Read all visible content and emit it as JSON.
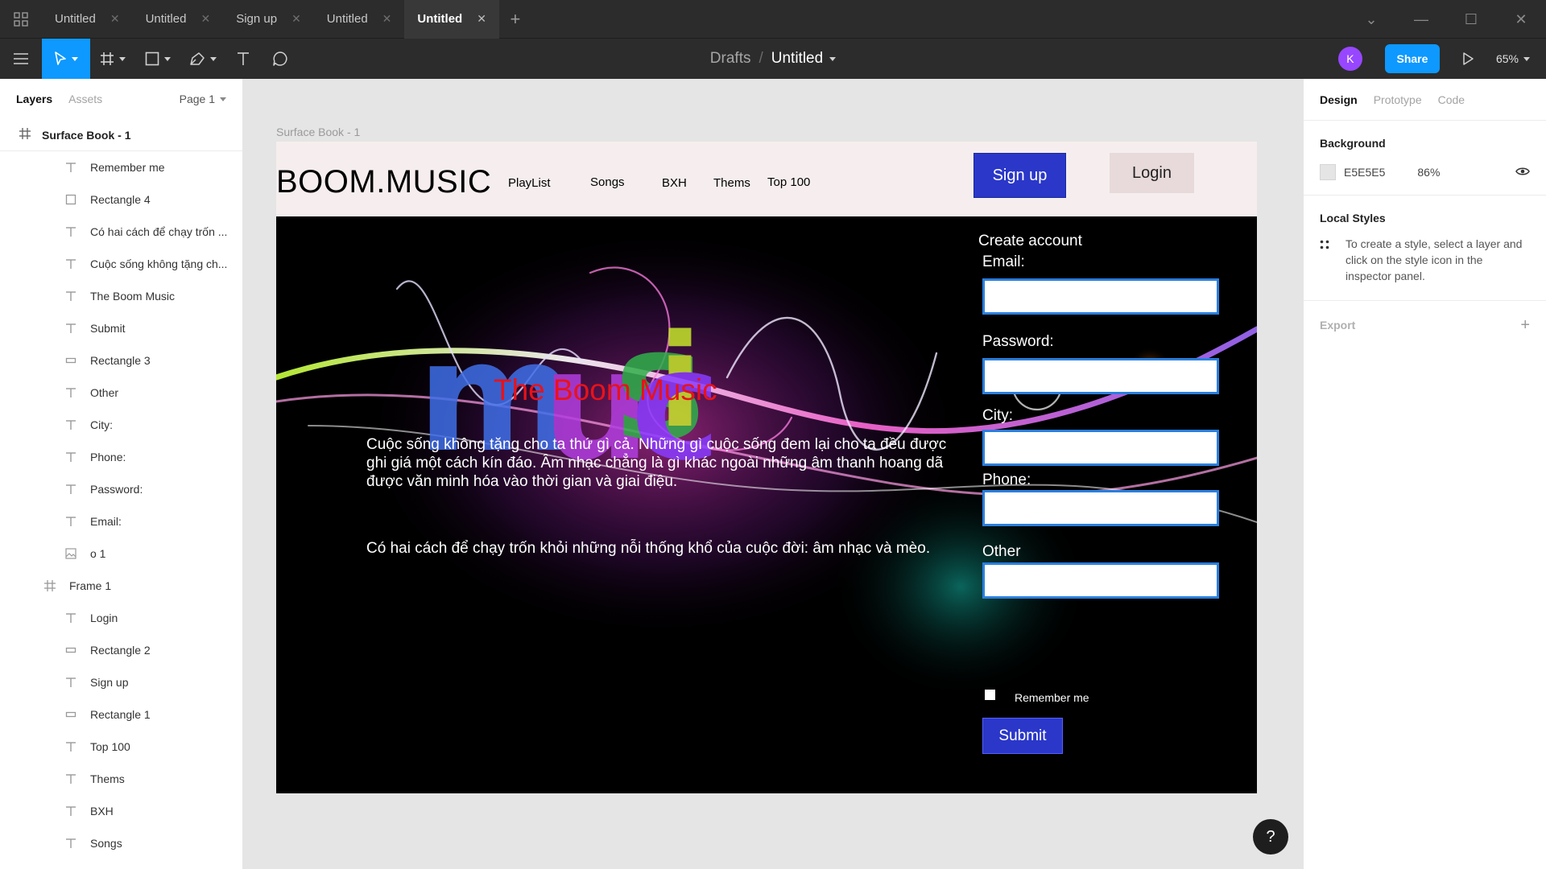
{
  "tabs": [
    {
      "label": "Untitled",
      "active": false
    },
    {
      "label": "Untitled",
      "active": false
    },
    {
      "label": "Sign up",
      "active": false
    },
    {
      "label": "Untitled",
      "active": false
    },
    {
      "label": "Untitled",
      "active": true
    }
  ],
  "toolbar": {
    "breadcrumb_parent": "Drafts",
    "breadcrumb_sep": "/",
    "file_name": "Untitled",
    "avatar_initial": "K",
    "share_label": "Share",
    "zoom": "65%",
    "accent": "#0d99ff"
  },
  "left_panel": {
    "tab_layers": "Layers",
    "tab_assets": "Assets",
    "page": "Page 1",
    "top_frame": "Surface Book - 1",
    "layers": [
      {
        "label": "Remember me",
        "icon": "text-icon"
      },
      {
        "label": "Rectangle 4",
        "icon": "rectangle-icon"
      },
      {
        "label": "Có hai cách để chạy trốn ...",
        "icon": "text-icon"
      },
      {
        "label": "Cuộc sống không tặng ch...",
        "icon": "text-icon"
      },
      {
        "label": "The Boom Music",
        "icon": "text-icon"
      },
      {
        "label": "Submit",
        "icon": "text-icon"
      },
      {
        "label": "Rectangle 3",
        "icon": "flat-rectangle-icon"
      },
      {
        "label": "Other",
        "icon": "text-icon"
      },
      {
        "label": "City:",
        "icon": "text-icon"
      },
      {
        "label": "Phone:",
        "icon": "text-icon"
      },
      {
        "label": "Password:",
        "icon": "text-icon"
      },
      {
        "label": "Email:",
        "icon": "text-icon"
      },
      {
        "label": "o 1",
        "icon": "image-icon"
      },
      {
        "label": "Frame 1",
        "icon": "frame-icon",
        "frame": true
      },
      {
        "label": "Login",
        "icon": "text-icon"
      },
      {
        "label": "Rectangle 2",
        "icon": "flat-rectangle-icon"
      },
      {
        "label": "Sign up",
        "icon": "text-icon"
      },
      {
        "label": "Rectangle 1",
        "icon": "flat-rectangle-icon"
      },
      {
        "label": "Top 100",
        "icon": "text-icon"
      },
      {
        "label": "Thems",
        "icon": "text-icon"
      },
      {
        "label": "BXH",
        "icon": "text-icon"
      },
      {
        "label": "Songs",
        "icon": "text-icon"
      }
    ]
  },
  "canvas": {
    "frame_label": "Surface Book - 1",
    "site": {
      "brand": "BOOM.MUSIC",
      "nav": [
        "PlayList",
        "Songs",
        "BXH",
        "Thems",
        "Top 100"
      ],
      "signup_label": "Sign up",
      "login_label": "Login",
      "hero_title": "The Boom Music",
      "hero_p1": "Cuộc sống không tặng cho ta thứ gì cả. Những gì cuộc sống đem lại cho ta đều được ghi giá một cách kín đáo. Âm nhạc chẳng là gì khác ngoài những âm thanh hoang dã được văn minh hóa vào thời gian và giai điệu.",
      "hero_p2": "Có hai cách để chạy trốn khỏi những nỗi thống khổ của cuộc đời: âm nhạc và mèo.",
      "form": {
        "heading": "Create account",
        "email_label": "Email:",
        "password_label": "Password:",
        "city_label": "City:",
        "phone_label": "Phone:",
        "other_label": "Other",
        "remember_label": "Remember me",
        "submit_label": "Submit"
      }
    }
  },
  "right_panel": {
    "tab_design": "Design",
    "tab_prototype": "Prototype",
    "tab_code": "Code",
    "background_title": "Background",
    "bg_hex": "E5E5E5",
    "bg_opacity": "86%",
    "local_styles_title": "Local Styles",
    "local_styles_hint": "To create a style, select a layer and click on the style icon in the inspector panel.",
    "export_title": "Export"
  },
  "help_label": "?"
}
